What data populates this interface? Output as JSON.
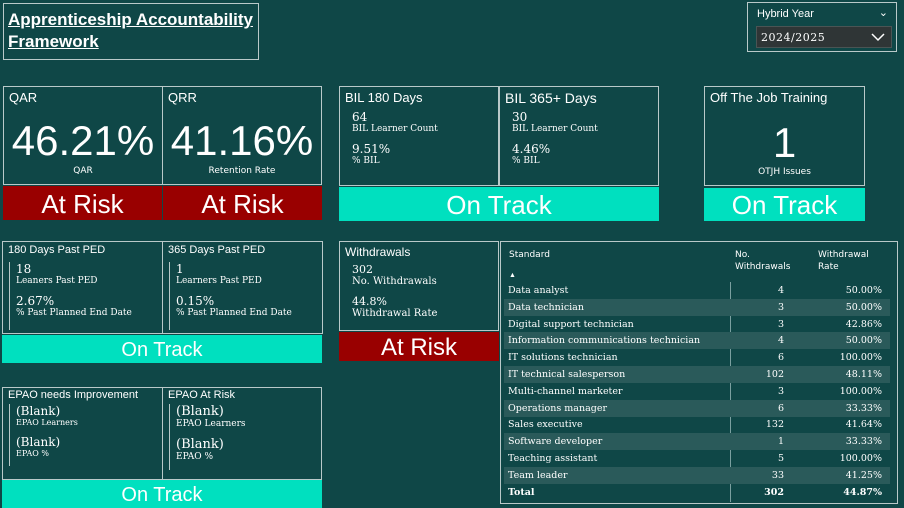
{
  "title": "Apprenticeship Accountability\nFramework",
  "slicer": {
    "label": "Hybrid Year",
    "value": "2024/2025"
  },
  "qar": {
    "header": "QAR",
    "value": "46.21%",
    "caption": "QAR",
    "status": "At Risk"
  },
  "qrr": {
    "header": "QRR",
    "value": "41.16%",
    "caption": "Retention Rate",
    "status": "At Risk"
  },
  "bil180": {
    "header": "BIL 180 Days",
    "count": "64",
    "count_label": "BIL Learner Count",
    "pct": "9.51%",
    "pct_label": "% BIL"
  },
  "bil365": {
    "header": "BIL 365+ Days",
    "count": "30",
    "count_label": "BIL Learner Count",
    "pct": "4.46%",
    "pct_label": "% BIL"
  },
  "bil_status": "On Track",
  "otj": {
    "header": "Off The Job Training",
    "value": "1",
    "caption": "OTJH Issues",
    "status": "On Track"
  },
  "ped180": {
    "header": "180 Days Past PED",
    "count": "18",
    "count_label": "Leaners Past PED",
    "pct": "2.67%",
    "pct_label": "% Past Planned End Date"
  },
  "ped365": {
    "header": "365 Days Past PED",
    "count": "1",
    "count_label": "Learners Past PED",
    "pct": "0.15%",
    "pct_label": "% Past Planned End Date"
  },
  "ped_status": "On Track",
  "withdrawals": {
    "header": "Withdrawals",
    "count": "302",
    "count_label": "No. Withdrawals",
    "pct": "44.8%",
    "pct_label": "Withdrawal Rate",
    "status": "At Risk"
  },
  "epao_improve": {
    "header": "EPAO needs Improvement",
    "learners": "(Blank)",
    "learners_label": "EPAO Learners",
    "pct": "(Blank)",
    "pct_label": "EPAO %"
  },
  "epao_risk": {
    "header": "EPAO At Risk",
    "learners": "(Blank)",
    "learners_label": "EPAO Learners",
    "pct": "(Blank)",
    "pct_label": "EPAO %"
  },
  "epao_status": "On Track",
  "table": {
    "headers": {
      "standard": "Standard",
      "withdrawals": "No. Withdrawals",
      "rate": "Withdrawal Rate"
    },
    "rows": [
      {
        "standard": "Data analyst",
        "withdrawals": "4",
        "rate": "50.00%"
      },
      {
        "standard": "Data technician",
        "withdrawals": "3",
        "rate": "50.00%"
      },
      {
        "standard": "Digital support technician",
        "withdrawals": "3",
        "rate": "42.86%"
      },
      {
        "standard": "Information communications technician",
        "withdrawals": "4",
        "rate": "50.00%"
      },
      {
        "standard": "IT solutions technician",
        "withdrawals": "6",
        "rate": "100.00%"
      },
      {
        "standard": "IT technical salesperson",
        "withdrawals": "102",
        "rate": "48.11%"
      },
      {
        "standard": "Multi-channel marketer",
        "withdrawals": "3",
        "rate": "100.00%"
      },
      {
        "standard": "Operations manager",
        "withdrawals": "6",
        "rate": "33.33%"
      },
      {
        "standard": "Sales executive",
        "withdrawals": "132",
        "rate": "41.64%"
      },
      {
        "standard": "Software developer",
        "withdrawals": "1",
        "rate": "33.33%"
      },
      {
        "standard": "Teaching assistant",
        "withdrawals": "5",
        "rate": "100.00%"
      },
      {
        "standard": "Team leader",
        "withdrawals": "33",
        "rate": "41.25%"
      }
    ],
    "total": {
      "standard": "Total",
      "withdrawals": "302",
      "rate": "44.87%"
    }
  },
  "colors": {
    "background": "#0f4747",
    "at_risk": "#990000",
    "on_track": "#00e0bf",
    "border": "#b9c9c9"
  },
  "icons": {
    "slicer_chevron": "chevron-down-icon",
    "sort_indicator": "sort-asc-icon"
  }
}
